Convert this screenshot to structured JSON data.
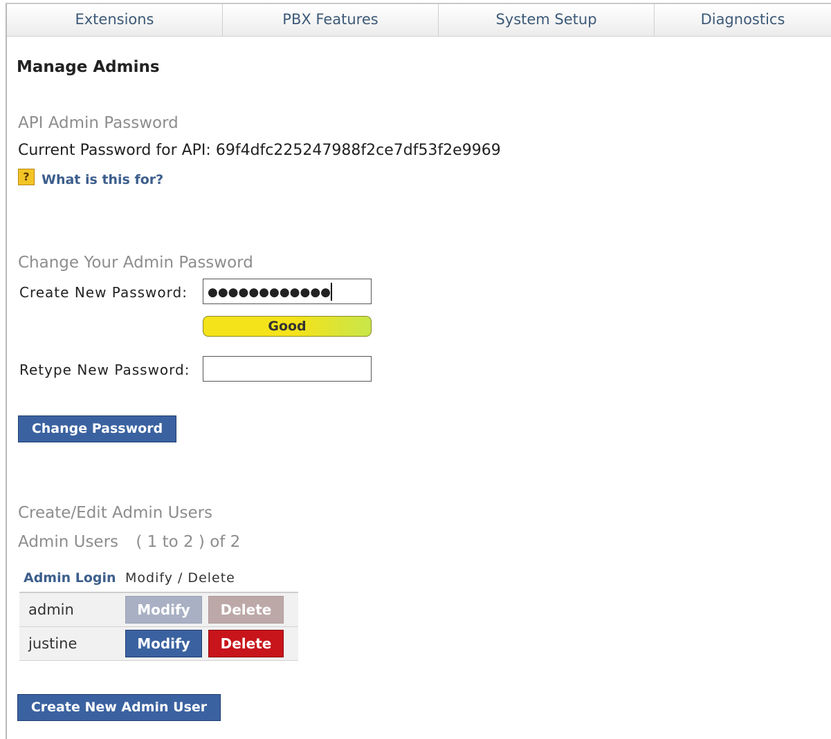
{
  "tabs": [
    "Extensions",
    "PBX Features",
    "System Setup",
    "Diagnostics"
  ],
  "page_title": "Manage Admins",
  "api": {
    "section_label": "API Admin Password",
    "current_password_label": "Current Password for API:",
    "current_password_value": "69f4dfc225247988f2ce7df53f2e9969",
    "help_icon_glyph": "?",
    "help_link": "What is this for?"
  },
  "change_password": {
    "section_label": "Change Your Admin Password",
    "new_label": "Create New Password:",
    "new_value": "●●●●●●●●●●●●",
    "strength": "Good",
    "retype_label": "Retype New Password:",
    "retype_value": "",
    "button": "Change Password"
  },
  "admin_users": {
    "section_label": "Create/Edit Admin Users",
    "list_title": "Admin Users",
    "range_text": "( 1 to 2 ) of 2",
    "col_login": "Admin Login",
    "col_actions": "Modify / Delete",
    "rows": [
      {
        "login": "admin",
        "modify": "Modify",
        "delete": "Delete",
        "enabled": false
      },
      {
        "login": "justine",
        "modify": "Modify",
        "delete": "Delete",
        "enabled": true
      }
    ],
    "create_button": "Create New Admin User"
  },
  "colors": {
    "primary_blue": "#3b62a0",
    "delete_red": "#c8141b",
    "disabled_blue": "#a9b0c4",
    "disabled_red": "#bda8a8",
    "strength_yellow": "#f4e21a"
  }
}
